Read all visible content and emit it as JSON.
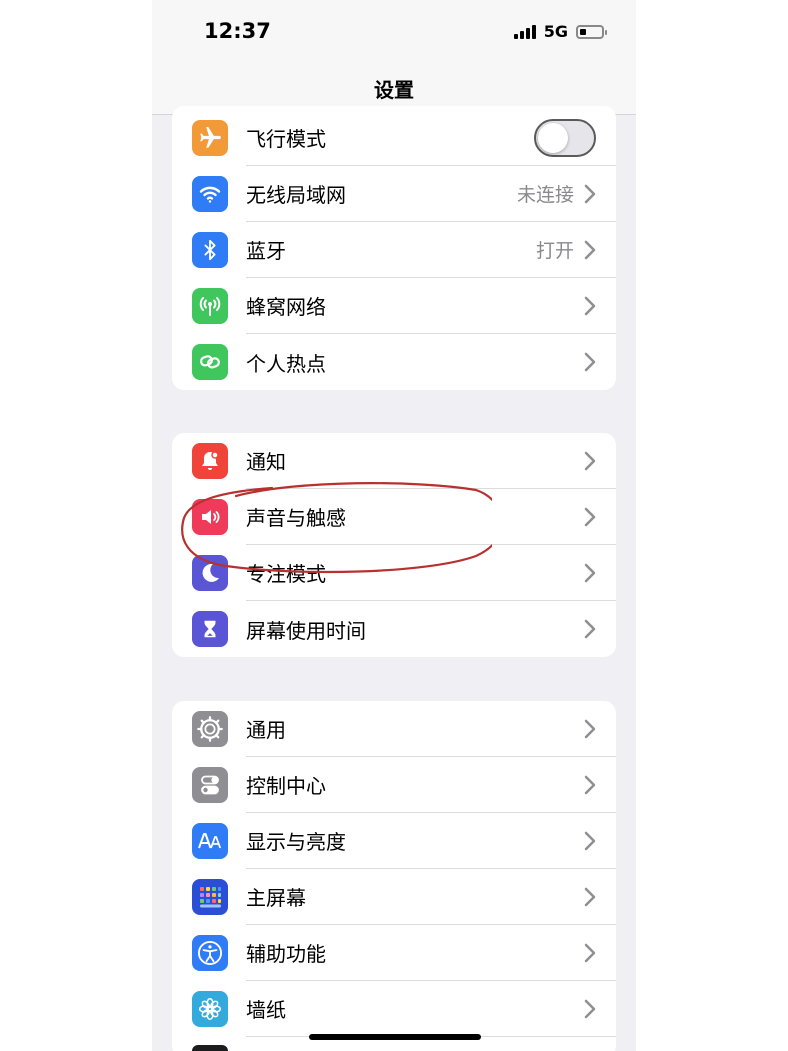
{
  "status_bar": {
    "time": "12:37",
    "network": "5G"
  },
  "nav": {
    "title": "设置"
  },
  "colors": {
    "airplane": "#f19a37",
    "wifi": "#2f7cf6",
    "bluetooth": "#2f7cf6",
    "cellular": "#3fc75d",
    "hotspot": "#3fc75d",
    "notifications": "#f0443a",
    "sounds": "#f03a5a",
    "focus": "#5a55d6",
    "screen_time": "#5a55d6",
    "general": "#8e8e93",
    "control_center": "#8e8e93",
    "display": "#2f7cf6",
    "home_screen": "#2a4fd6",
    "accessibility": "#2f7cf6",
    "wallpaper": "#34aadc",
    "annotation": "#b8312f"
  },
  "group1": {
    "airplane": {
      "label": "飞行模式",
      "icon": "airplane-icon"
    },
    "wifi": {
      "label": "无线局域网",
      "value": "未连接",
      "icon": "wifi-icon"
    },
    "bluetooth": {
      "label": "蓝牙",
      "value": "打开",
      "icon": "bluetooth-icon"
    },
    "cellular": {
      "label": "蜂窝网络",
      "icon": "antenna-icon"
    },
    "hotspot": {
      "label": "个人热点",
      "icon": "link-icon"
    }
  },
  "group2": {
    "notifications": {
      "label": "通知",
      "icon": "bell-icon"
    },
    "sounds": {
      "label": "声音与触感",
      "icon": "speaker-icon"
    },
    "focus": {
      "label": "专注模式",
      "icon": "moon-icon"
    },
    "screen_time": {
      "label": "屏幕使用时间",
      "icon": "hourglass-icon"
    }
  },
  "group3": {
    "general": {
      "label": "通用",
      "icon": "gear-icon"
    },
    "control_center": {
      "label": "控制中心",
      "icon": "toggles-icon"
    },
    "display": {
      "label": "显示与亮度",
      "icon": "text-size-icon"
    },
    "home_screen": {
      "label": "主屏幕",
      "icon": "app-grid-icon"
    },
    "accessibility": {
      "label": "辅助功能",
      "icon": "accessibility-icon"
    },
    "wallpaper": {
      "label": "墙纸",
      "icon": "flower-icon"
    }
  },
  "toggle_state": {
    "airplane_on": false
  }
}
